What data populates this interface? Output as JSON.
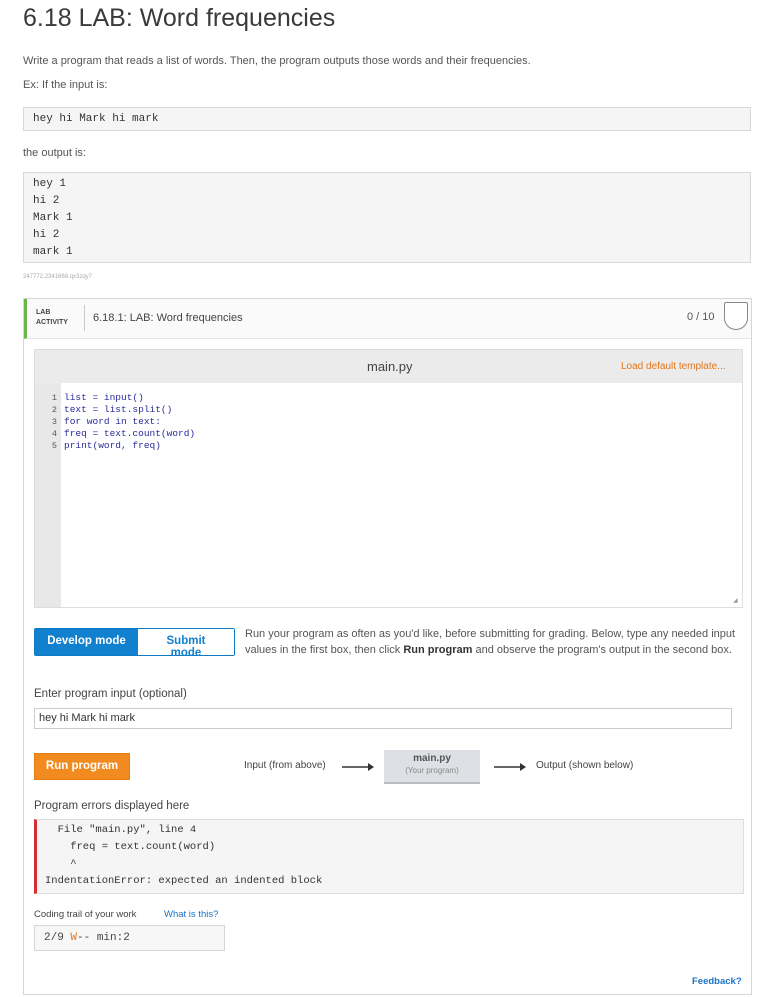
{
  "title": "6.18 LAB: Word frequencies",
  "desc": "Write a program that reads a list of words. Then, the program outputs those words and their frequencies.",
  "ex_label": "Ex: If the input is:",
  "ex_input": "hey hi Mark hi mark",
  "output_label": "the output is:",
  "ex_output": "hey 1\nhi 2\nMark 1\nhi 2\nmark 1",
  "id_code": "247772.2341668.qx3zqy7",
  "lab": {
    "tag_line1": "LAB",
    "tag_line2": "ACTIVITY",
    "name": "6.18.1: LAB: Word frequencies",
    "score": "0 / 10"
  },
  "editor": {
    "filename": "main.py",
    "load_template": "Load default template...",
    "lines": [
      "list = input()",
      "text = list.split()",
      "for word in text:",
      "freq = text.count(word)",
      "print(word, freq)"
    ],
    "line_numbers": [
      "1",
      "2",
      "3",
      "4",
      "5"
    ]
  },
  "modes": {
    "develop": "Develop mode",
    "submit": "Submit mode",
    "desc_a": "Run your program as often as you'd like, before submitting for grading. Below, type any needed input values in the first box, then click ",
    "desc_bold": "Run program",
    "desc_b": " and observe the program's output in the second box."
  },
  "input_section": {
    "label": "Enter program input (optional)",
    "value": "hey hi Mark hi mark"
  },
  "run": {
    "button": "Run program",
    "flow_input": "Input (from above)",
    "flow_box_title": "main.py",
    "flow_box_sub": "(Your program)",
    "flow_output": "Output (shown below)"
  },
  "errors": {
    "label": "Program errors displayed here",
    "text": "  File \"main.py\", line 4\n    freq = text.count(word)\n    ^\nIndentationError: expected an indented block"
  },
  "trail": {
    "label": "Coding trail of your work",
    "link": "What is this?",
    "prefix": "2/9 ",
    "w": "W",
    "suffix": "-- min:2"
  },
  "feedback": "Feedback?"
}
